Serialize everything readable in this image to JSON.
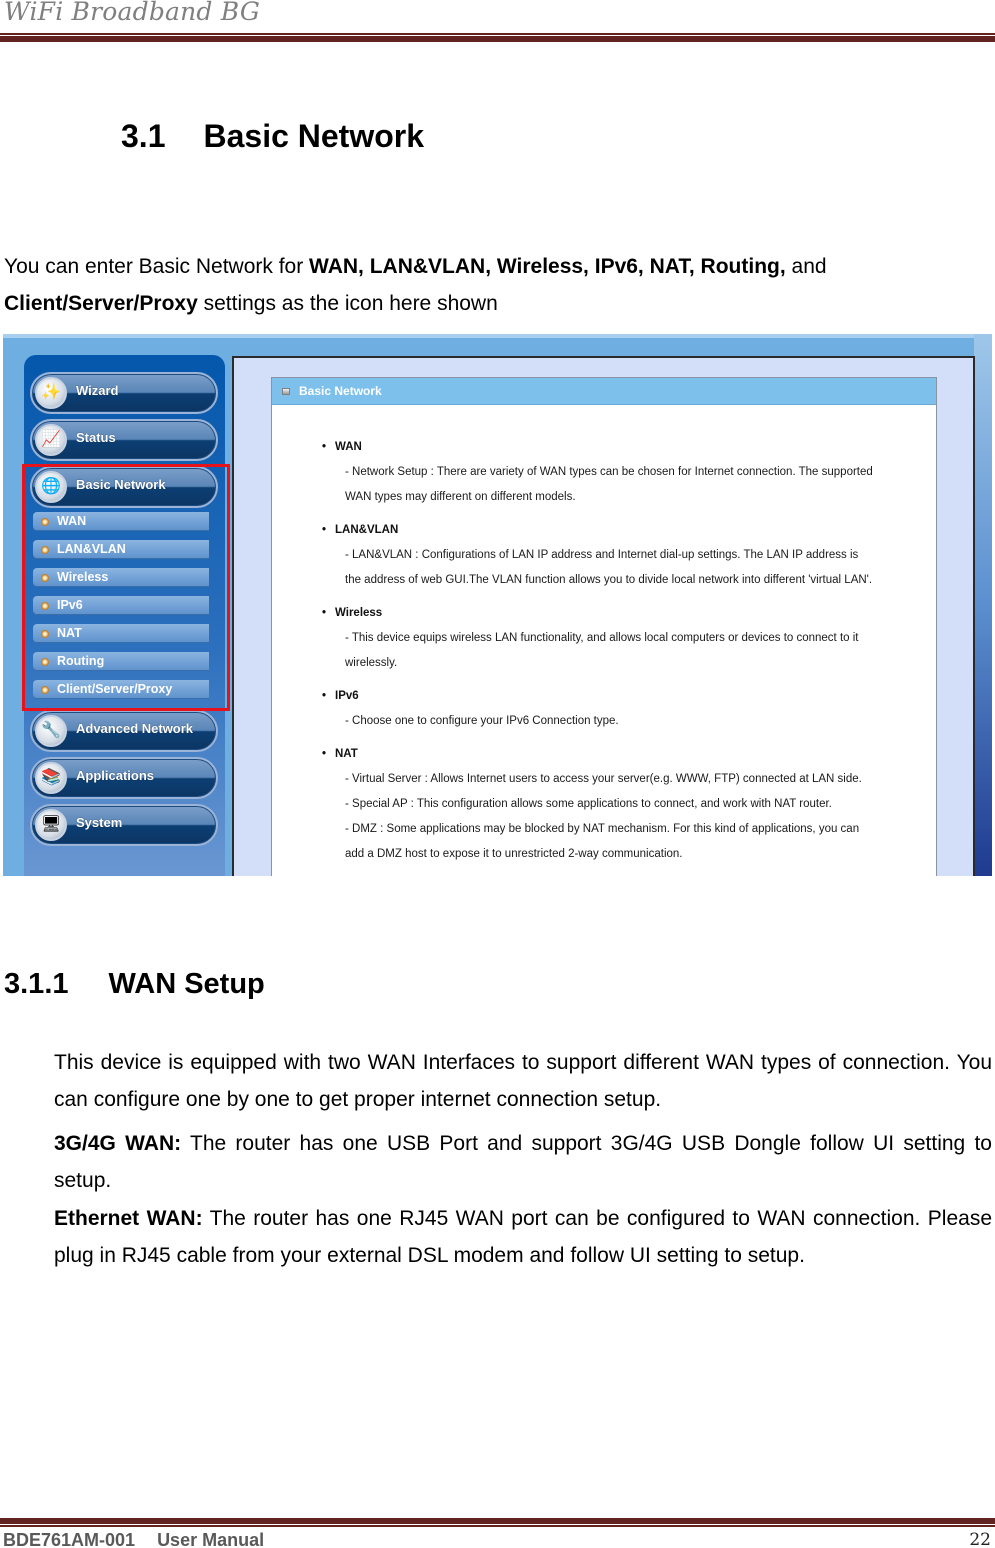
{
  "header": {
    "brand": "WiFi Broadband BG"
  },
  "section": {
    "number": "3.1",
    "title": "Basic Network",
    "intro": {
      "prefix": "You can enter Basic Network for ",
      "bold_items": "WAN, LAN&VLAN, Wireless, IPv6, NAT, Routing,",
      "middle": " and ",
      "bold_last": "Client/Server/Proxy",
      "suffix": " settings as the icon here shown"
    }
  },
  "screenshot": {
    "sidebar": {
      "top_buttons": [
        {
          "label": "Wizard",
          "icon": "magic-wand-icon",
          "glyph": "✨"
        },
        {
          "label": "Status",
          "icon": "chart-icon",
          "glyph": "📈"
        },
        {
          "label": "Basic Network",
          "icon": "globe-icon",
          "glyph": "🌐"
        }
      ],
      "sub_items": [
        {
          "label": "WAN"
        },
        {
          "label": "LAN&VLAN"
        },
        {
          "label": "Wireless"
        },
        {
          "label": "IPv6"
        },
        {
          "label": "NAT"
        },
        {
          "label": "Routing"
        },
        {
          "label": "Client/Server/Proxy"
        }
      ],
      "bottom_buttons": [
        {
          "label": "Advanced Network",
          "icon": "tools-icon",
          "glyph": "🔧"
        },
        {
          "label": "Applications",
          "icon": "books-icon",
          "glyph": "📚"
        },
        {
          "label": "System",
          "icon": "monitor-icon",
          "glyph": "🖥"
        }
      ],
      "highlight_color": "#e8121a"
    },
    "panel": {
      "title": "Basic Network",
      "sections": [
        {
          "title": "WAN",
          "lines": [
            "- Network Setup : There are variety of WAN types can be chosen for Internet connection. The supported",
            "WAN types may different on different models."
          ]
        },
        {
          "title": "LAN&VLAN",
          "lines": [
            "- LAN&VLAN : Configurations of LAN IP address and Internet dial-up settings. The LAN IP address is",
            "the address of web GUI.The VLAN function allows you to divide local network into different 'virtual LAN'."
          ]
        },
        {
          "title": "Wireless",
          "lines": [
            "- This device equips wireless LAN functionality, and allows local computers or devices to connect to it",
            "wirelessly."
          ]
        },
        {
          "title": "IPv6",
          "lines": [
            "- Choose one to configure your IPv6 Connection type."
          ]
        },
        {
          "title": "NAT",
          "lines": [
            "- Virtual Server : Allows Internet users to access your server(e.g. WWW, FTP) connected at LAN side.",
            "- Special AP : This configuration allows some applications to connect, and work with NAT router.",
            "- DMZ : Some applications may be blocked by NAT mechanism. For this kind of applications, you can",
            "add a DMZ host to expose it to unrestricted 2-way communication."
          ]
        }
      ]
    }
  },
  "subsection": {
    "number": "3.1.1",
    "title": "WAN Setup",
    "para1": "This device is equipped with two WAN Interfaces to support different WAN types of connection. You can configure one by one to get proper internet connection setup.",
    "para2_label": "3G/4G WAN:",
    "para2_text": " The router has one USB Port and support 3G/4G USB Dongle follow UI setting to setup.",
    "para3_label": "Ethernet WAN:",
    "para3_text": " The router has one RJ45 WAN port can be configured to WAN connection. Please plug in RJ45 cable from your external DSL modem and follow UI setting to setup."
  },
  "footer": {
    "doc_id": "BDE761AM-001",
    "doc_type": "User Manual",
    "page_number": "22"
  },
  "colors": {
    "rule": "#622423",
    "brand_text": "#7f7f7f",
    "panel_header": "#7ec0ec",
    "content_bg": "#d3def8"
  }
}
